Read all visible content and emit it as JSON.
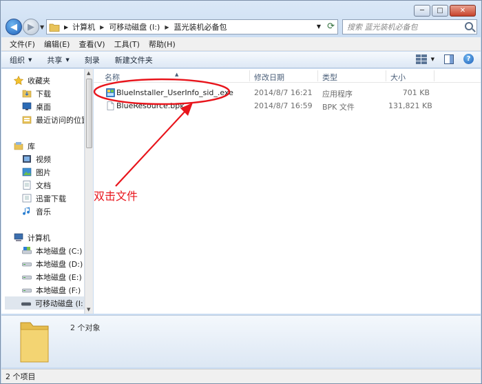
{
  "window": {
    "caption_minimize": "─",
    "caption_maximize": "□",
    "caption_close": "✕"
  },
  "address": {
    "crumbs": [
      "计算机",
      "可移动磁盘 (I:)",
      "蓝光装机必备包"
    ]
  },
  "search": {
    "placeholder": "搜索 蓝光装机必备包"
  },
  "menu": {
    "items": [
      "文件(F)",
      "编辑(E)",
      "查看(V)",
      "工具(T)",
      "帮助(H)"
    ]
  },
  "toolbar": {
    "organize": "组织",
    "share": "共享",
    "burn": "刻录",
    "new_folder": "新建文件夹"
  },
  "navpane": {
    "favorites": {
      "label": "收藏夹",
      "items": [
        "下载",
        "桌面",
        "最近访问的位置"
      ]
    },
    "libraries": {
      "label": "库",
      "items": [
        "视频",
        "图片",
        "文档",
        "迅雷下载",
        "音乐"
      ]
    },
    "computer": {
      "label": "计算机",
      "items": [
        "本地磁盘 (C:)",
        "本地磁盘 (D:)",
        "本地磁盘 (E:)",
        "本地磁盘 (F:)",
        "可移动磁盘 (I:)"
      ]
    }
  },
  "columns": {
    "name": "名称",
    "date": "修改日期",
    "type": "类型",
    "size": "大小"
  },
  "files": [
    {
      "name": "BlueInstaller_UserInfo_sid_.exe",
      "date": "2014/8/7 16:21",
      "type": "应用程序",
      "size": "701 KB"
    },
    {
      "name": "BlueResource.bpk",
      "date": "2014/8/7 16:59",
      "type": "BPK 文件",
      "size": "131,821 KB"
    }
  ],
  "annotation": {
    "text": "双击文件",
    "color": "#e8141b"
  },
  "details": {
    "count": "2 个对象"
  },
  "status": {
    "text": "2 个项目"
  }
}
